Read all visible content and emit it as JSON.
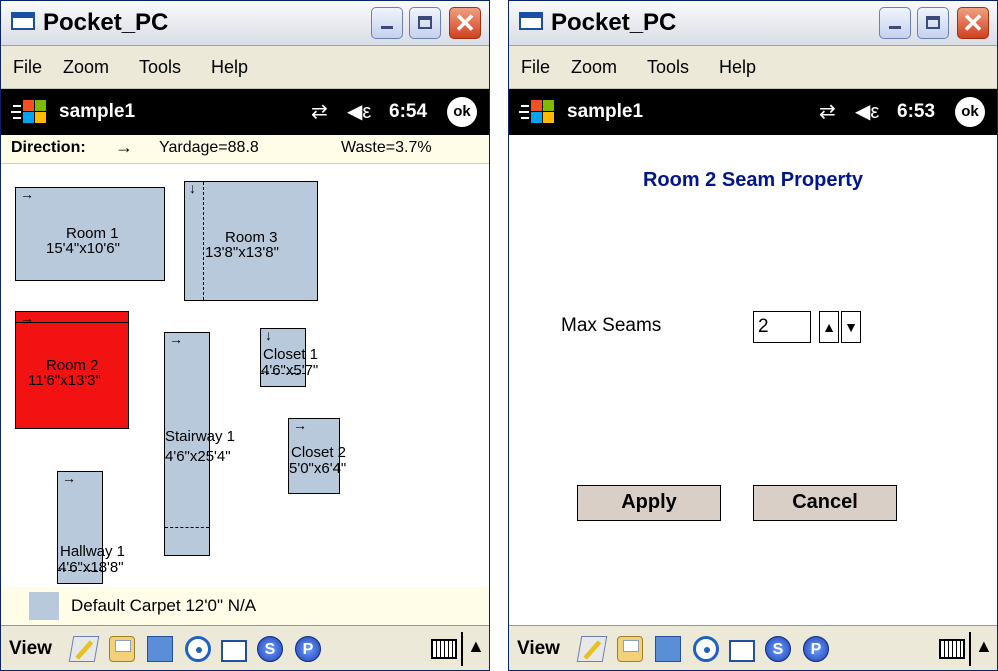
{
  "windows": [
    {
      "title": "Pocket_PC",
      "menu": [
        "File",
        "Zoom",
        "Tools",
        "Help"
      ],
      "status": {
        "doc": "sample1",
        "conn_icon": "⇄",
        "vol_icon": "◀ε",
        "time": "6:54",
        "ok": "ok"
      },
      "info": {
        "direction_label": "Direction:",
        "direction_arrow": "→",
        "yardage": "Yardage=88.8",
        "waste": "Waste=3.7%"
      },
      "rooms": [
        {
          "name": "Room 1",
          "size": "15'4\"x10'6\"",
          "dir": "→",
          "selected": false
        },
        {
          "name": "Room 3",
          "size": "13'8\"x13'8\"",
          "dir": "↓",
          "selected": false
        },
        {
          "name": "Room 2",
          "size": "11'6\"x13'3\"",
          "dir": "→",
          "selected": true
        },
        {
          "name": "Stairway 1",
          "size": "4'6\"x25'4\"",
          "dir": "→",
          "selected": false
        },
        {
          "name": "Closet 1",
          "size": "4'6\"x5'7\"",
          "dir": "↓",
          "selected": false
        },
        {
          "name": "Closet 2",
          "size": "5'0\"x6'4\"",
          "dir": "→",
          "selected": false
        },
        {
          "name": "Hallway 1",
          "size": "4'6\"x18'8\"",
          "dir": "→",
          "selected": false
        }
      ],
      "legend": {
        "text": "Default Carpet 12'0\" N/A"
      },
      "bottom": {
        "view_label": "View",
        "s_label": "S",
        "p_label": "P",
        "sip_arrow": "▲"
      }
    },
    {
      "title": "Pocket_PC",
      "menu": [
        "File",
        "Zoom",
        "Tools",
        "Help"
      ],
      "status": {
        "doc": "sample1",
        "conn_icon": "⇄",
        "vol_icon": "◀ε",
        "time": "6:53",
        "ok": "ok"
      },
      "dialog": {
        "title": "Room 2 Seam Property",
        "field_label": "Max Seams",
        "field_value": "2",
        "spin_up": "▲",
        "spin_down": "▼",
        "apply": "Apply",
        "cancel": "Cancel"
      },
      "bottom": {
        "view_label": "View",
        "s_label": "S",
        "p_label": "P",
        "sip_arrow": "▲"
      }
    }
  ],
  "colors": {
    "selected_room": "#f21212",
    "room_fill": "#b9c9dc",
    "dialog_title": "#00168a",
    "button_face": "#d9cfc6"
  }
}
